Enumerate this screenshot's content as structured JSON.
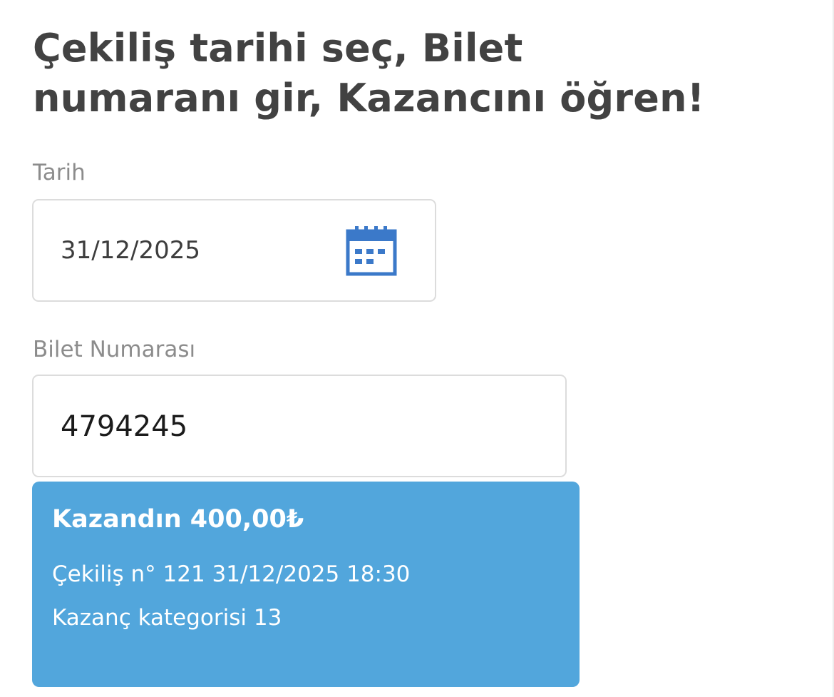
{
  "header": {
    "title_line1": "Çekiliş tarihi seç, Bilet",
    "title_line2": "numaranı gir, Kazancını öğren!"
  },
  "date_field": {
    "label": "Tarih",
    "value": "31/12/2025",
    "icon": "calendar-icon"
  },
  "ticket_field": {
    "label": "Bilet Numarası",
    "value": "4794245"
  },
  "result": {
    "title": "Kazandın 400,00₺",
    "draw_info": "Çekiliş n° 121 31/12/2025 18:30",
    "category": "Kazanç kategorisi 13"
  },
  "colors": {
    "result_background": "#52a6dc",
    "calendar_icon": "#3b79c9",
    "title_text": "#424242",
    "label_text": "#8c8c8c",
    "input_border": "#dcdcdc"
  }
}
